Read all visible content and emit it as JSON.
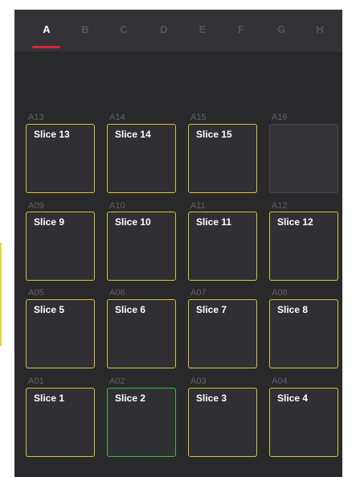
{
  "tabs": [
    {
      "label": "A",
      "active": true
    },
    {
      "label": "B",
      "active": false
    },
    {
      "label": "C",
      "active": false
    },
    {
      "label": "D",
      "active": false
    },
    {
      "label": "E",
      "active": false
    },
    {
      "label": "F",
      "active": false
    },
    {
      "label": "G",
      "active": false
    },
    {
      "label": "H",
      "active": false
    }
  ],
  "pads": [
    {
      "id": "A13",
      "label": "Slice 13",
      "state": "assigned"
    },
    {
      "id": "A14",
      "label": "Slice 14",
      "state": "assigned"
    },
    {
      "id": "A15",
      "label": "Slice 15",
      "state": "assigned"
    },
    {
      "id": "A16",
      "label": "",
      "state": "empty"
    },
    {
      "id": "A09",
      "label": "Slice 9",
      "state": "assigned"
    },
    {
      "id": "A10",
      "label": "Slice 10",
      "state": "assigned"
    },
    {
      "id": "A11",
      "label": "Slice 11",
      "state": "assigned"
    },
    {
      "id": "A12",
      "label": "Slice 12",
      "state": "assigned"
    },
    {
      "id": "A05",
      "label": "Slice 5",
      "state": "assigned"
    },
    {
      "id": "A06",
      "label": "Slice 6",
      "state": "assigned"
    },
    {
      "id": "A07",
      "label": "Slice 7",
      "state": "assigned"
    },
    {
      "id": "A08",
      "label": "Slice 8",
      "state": "assigned"
    },
    {
      "id": "A01",
      "label": "Slice 1",
      "state": "assigned"
    },
    {
      "id": "A02",
      "label": "Slice 2",
      "state": "selected"
    },
    {
      "id": "A03",
      "label": "Slice 3",
      "state": "assigned"
    },
    {
      "id": "A04",
      "label": "Slice 4",
      "state": "assigned"
    }
  ],
  "colors": {
    "assigned_border": "#d6c826",
    "selected_border": "#36c040",
    "active_tab_underline": "#d8283a"
  }
}
